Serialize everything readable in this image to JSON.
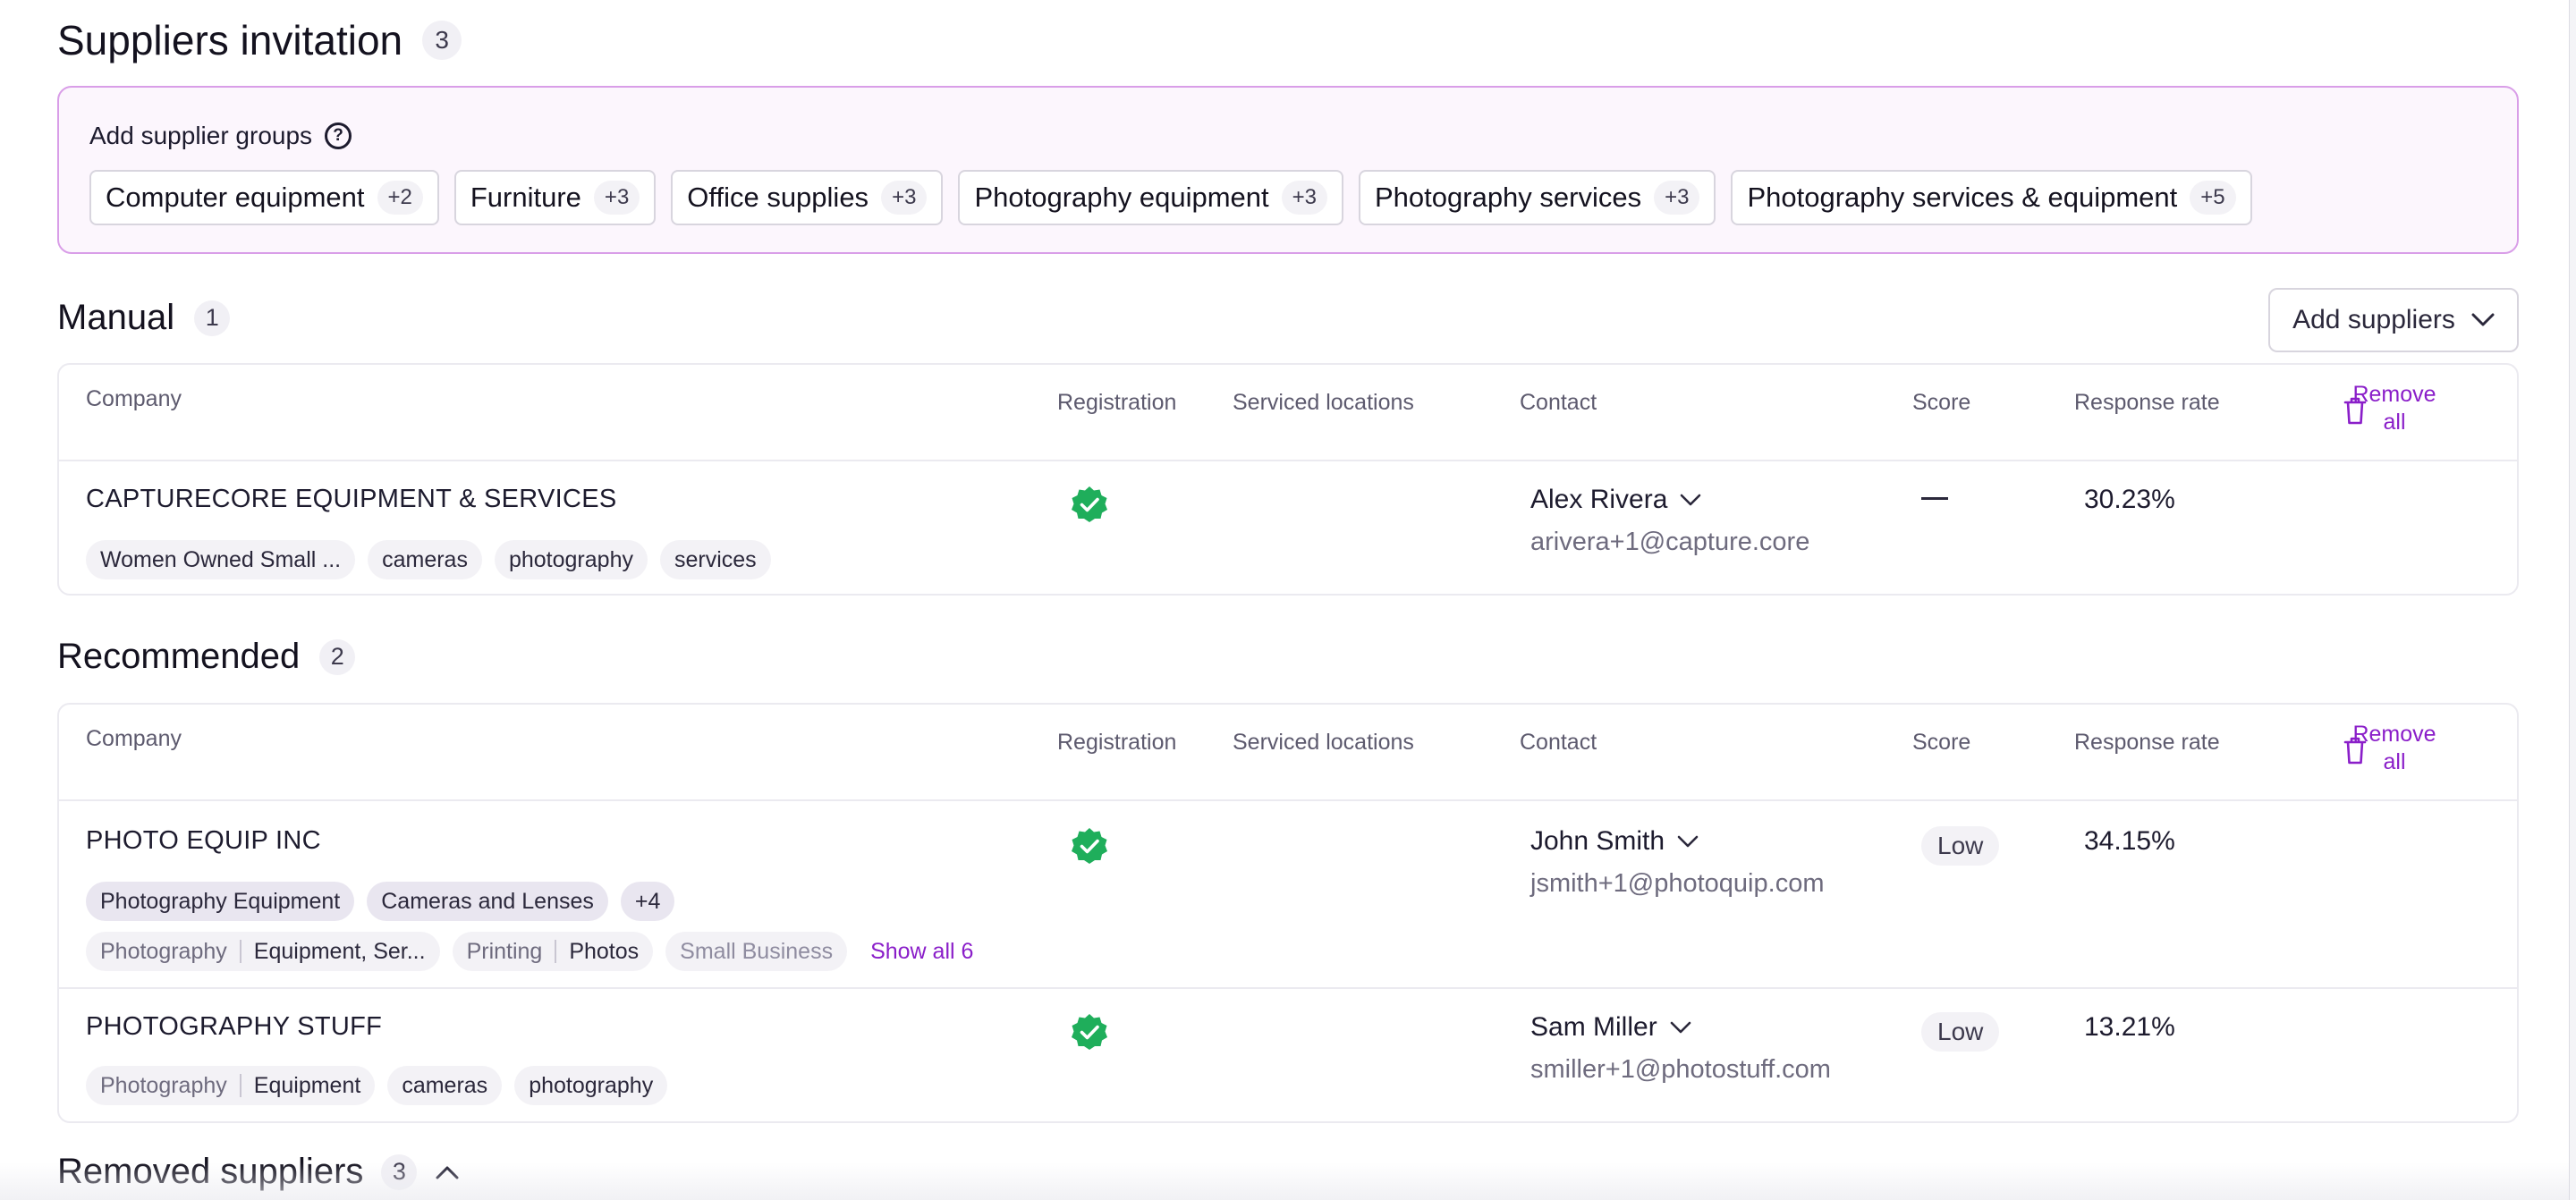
{
  "header": {
    "title": "Suppliers invitation",
    "count": "3"
  },
  "groups": {
    "label": "Add supplier groups",
    "items": [
      {
        "name": "Computer equipment",
        "count": "+2"
      },
      {
        "name": "Furniture",
        "count": "+3"
      },
      {
        "name": "Office supplies",
        "count": "+3"
      },
      {
        "name": "Photography equipment",
        "count": "+3"
      },
      {
        "name": "Photography services",
        "count": "+3"
      },
      {
        "name": "Photography services & equipment",
        "count": "+5"
      }
    ]
  },
  "add_suppliers_label": "Add suppliers",
  "columns": {
    "company": "Company",
    "registration": "Registration",
    "locations": "Serviced locations",
    "contact": "Contact",
    "score": "Score",
    "rate": "Response rate",
    "remove_all": "Remove all"
  },
  "manual": {
    "title": "Manual",
    "count": "1",
    "rows": [
      {
        "company": "CAPTURECORE EQUIPMENT & SERVICES",
        "tags": [
          "Women Owned Small ...",
          "cameras",
          "photography",
          "services"
        ],
        "contact_name": "Alex Rivera",
        "contact_email": "arivera+1@capture.core",
        "score": "—",
        "rate": "30.23%"
      }
    ]
  },
  "recommended": {
    "title": "Recommended",
    "count": "2",
    "rows": [
      {
        "company": "PHOTO EQUIP INC",
        "categories": [
          "Photography Equipment",
          "Cameras and Lenses",
          "+4"
        ],
        "tags": [
          {
            "cat": "Photography",
            "val": "Equipment, Ser..."
          },
          {
            "cat": "Printing",
            "val": "Photos"
          },
          {
            "val": "Small Business"
          }
        ],
        "show_all": "Show all 6",
        "contact_name": "John Smith",
        "contact_email": "jsmith+1@photoquip.com",
        "score": "Low",
        "rate": "34.15%"
      },
      {
        "company": "PHOTOGRAPHY STUFF",
        "tags": [
          {
            "cat": "Photography",
            "val": "Equipment"
          },
          {
            "val": "cameras"
          },
          {
            "val": "photography"
          }
        ],
        "contact_name": "Sam Miller",
        "contact_email": "smiller+1@photostuff.com",
        "score": "Low",
        "rate": "13.21%"
      }
    ]
  },
  "removed": {
    "title": "Removed suppliers",
    "count": "3"
  },
  "colors": {
    "accent": "#8a1ec9",
    "verified": "#1fae5b",
    "group_border": "#d99ee8"
  },
  "icons": [
    "help-icon",
    "chevron-down-icon",
    "trash-icon",
    "verified-badge-icon",
    "chevron-up-icon"
  ]
}
